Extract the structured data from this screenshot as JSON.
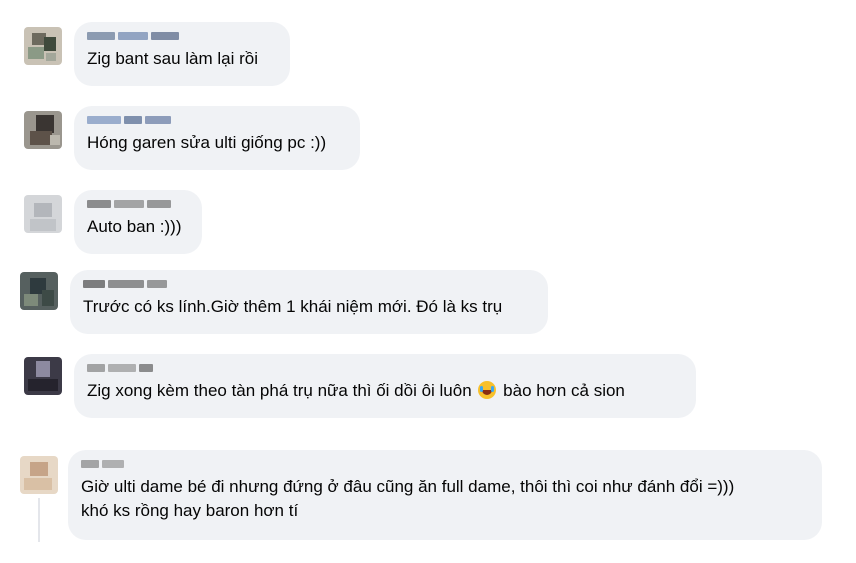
{
  "comments": [
    {
      "text": "Zig bant sau làm lại rồi"
    },
    {
      "text": "Hóng garen sửa ulti giống pc :))"
    },
    {
      "text": "Auto ban :)))"
    },
    {
      "text": "Trước có ks lính.Giờ thêm 1 khái niệm mới. Đó là ks trụ"
    },
    {
      "text_before": "Zig xong kèm theo tàn phá trụ nữa thì ối dồi ôi luôn",
      "emoji": "rolling-laughing-emoji",
      "text_after": "bào hơn cả sion"
    },
    {
      "line1": "Giờ ulti dame bé đi nhưng đứng ở đâu cũng ăn full dame, thôi thì coi như đánh đổi =)))",
      "line2": "khó ks rồng hay baron hơn tí"
    }
  ],
  "colors": {
    "bubble": "#f0f2f5",
    "text": "#050505"
  }
}
